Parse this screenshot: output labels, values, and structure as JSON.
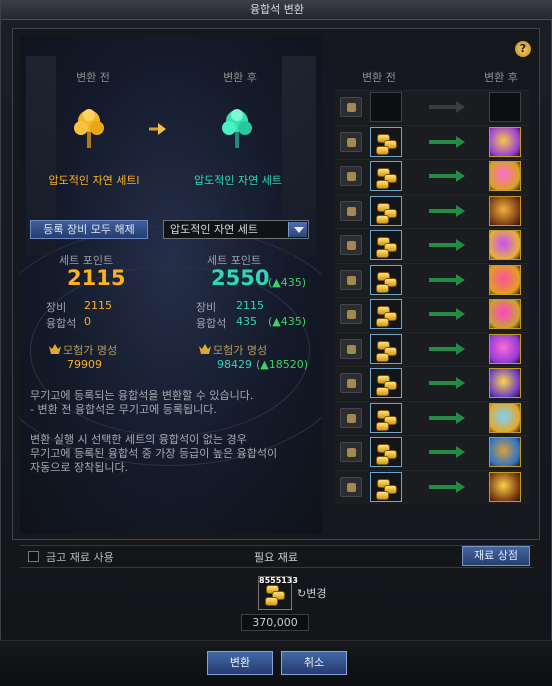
{
  "window": {
    "title": "융합석 변환"
  },
  "left": {
    "before_label": "변환 전",
    "after_label": "변환 후",
    "before_set": "압도적인 자연 세트l",
    "after_set": "압도적인 자연 세트",
    "clear_button": "등록 장비 모두 해제",
    "set_select": "압도적인 자연 세트",
    "before_points_label": "세트 포인트",
    "before_points": "2115",
    "after_points_label": "세트 포인트",
    "after_points": "2550",
    "after_points_delta": "(▲435)",
    "before_equip_label": "장비",
    "before_equip_value": "2115",
    "before_fusion_label": "융합석",
    "before_fusion_value": "0",
    "after_equip_label": "장비",
    "after_equip_value": "2115",
    "after_fusion_label": "융합석",
    "after_fusion_value": "435",
    "after_fusion_delta": "(▲435)",
    "before_fame_label": "모험가 명성",
    "before_fame_value": "79909",
    "after_fame_label": "모험가 명성",
    "after_fame_value": "98429",
    "after_fame_delta": "(▲18520)",
    "desc_lines": [
      "무기고에 등록되는 융합석을 변환할 수 있습니다.",
      "- 변환 전 융합석은 무기고에 등록됩니다.",
      "",
      "변환 실행 시 선택한 세트의 융합석이 없는 경우",
      "무기고에 등록된 융합석 중 가장 등급이 높은 융합석이",
      "자동으로 장착됩니다."
    ]
  },
  "right": {
    "before_label": "변환 전",
    "after_label": "변환 후"
  },
  "rows": [
    {
      "slot": "weapon-slot",
      "filled": false
    },
    {
      "slot": "top-slot",
      "filled": true
    },
    {
      "slot": "pants-slot",
      "filled": true
    },
    {
      "slot": "shoulder-slot",
      "filled": true
    },
    {
      "slot": "belt-slot",
      "filled": true
    },
    {
      "slot": "shoes-slot",
      "filled": true
    },
    {
      "slot": "bracelet-slot",
      "filled": true
    },
    {
      "slot": "necklace-slot",
      "filled": true
    },
    {
      "slot": "ring-slot",
      "filled": true
    },
    {
      "slot": "sub-equip-slot",
      "filled": true
    },
    {
      "slot": "magic-stone-slot",
      "filled": true
    },
    {
      "slot": "earring-slot",
      "filled": true
    }
  ],
  "bottom": {
    "use_vault_label": "금고 재료 사용",
    "required_label": "필요 재료",
    "store_button": "재료 상점",
    "material_count": "8555133",
    "change_label": "변경",
    "cost": "370,000",
    "convert_button": "변환",
    "cancel_button": "취소"
  },
  "colors": {
    "gold": "#ffb21e",
    "teal": "#2fd7b6",
    "arrow_green": "#1f8d44",
    "delta_green": "#39d36a"
  }
}
